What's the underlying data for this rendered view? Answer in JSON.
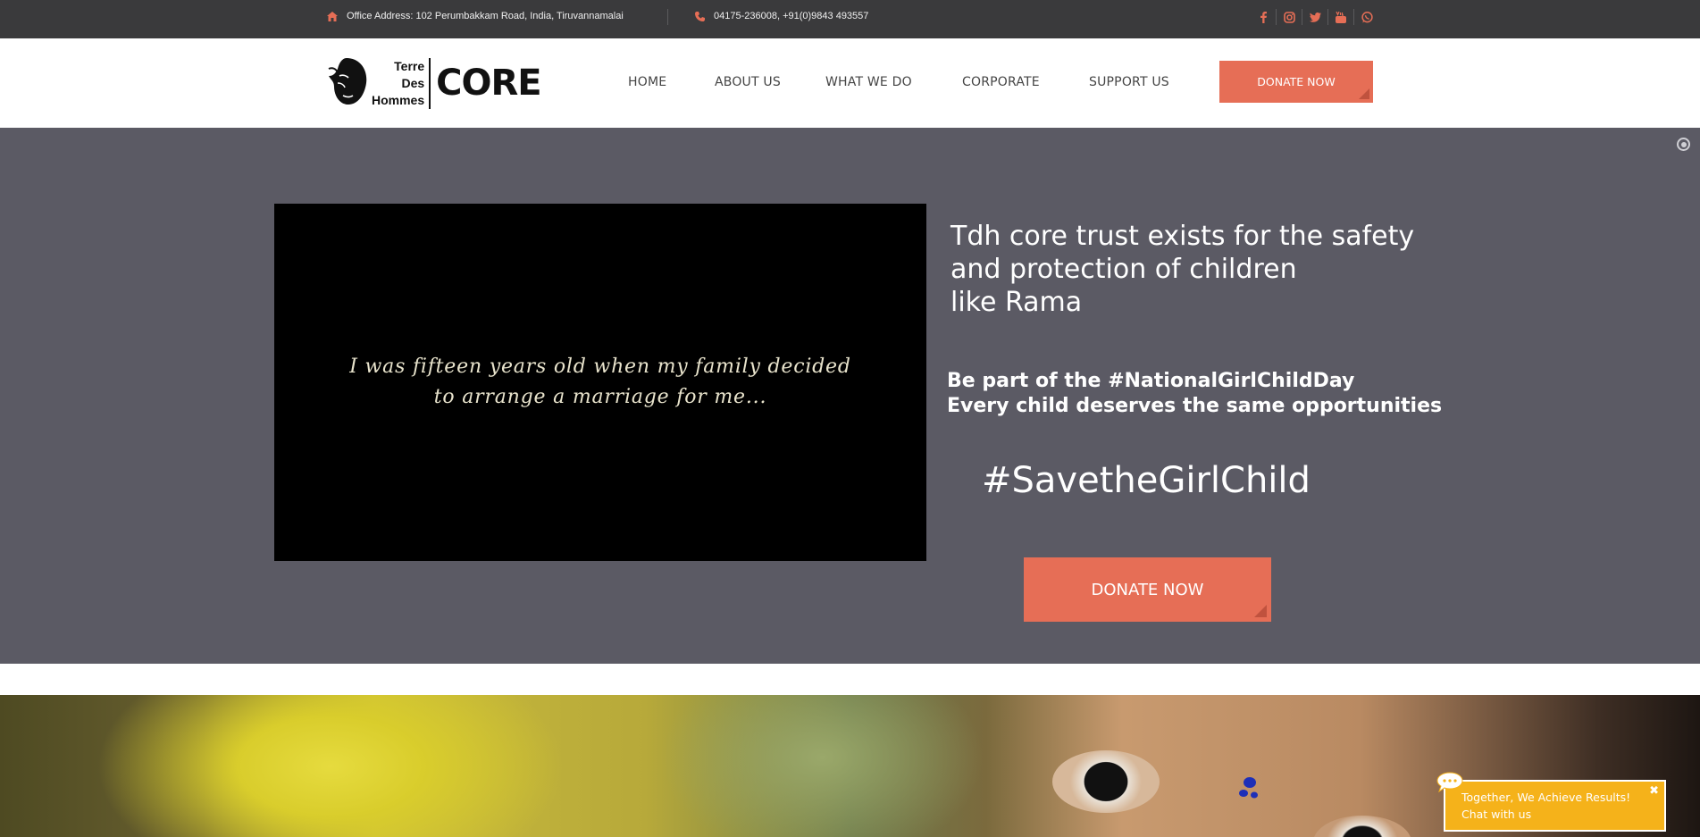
{
  "topbar": {
    "address": "Office Address: 102 Perumbakkam Road, India, Tiruvannamalai",
    "phone": "04175-236008, +91(0)9843 493557",
    "icons": [
      "home-icon",
      "phone-icon"
    ],
    "socials": [
      "facebook-icon",
      "instagram-icon",
      "twitter-icon",
      "youtube-icon",
      "whatsapp-icon"
    ]
  },
  "header": {
    "logo": {
      "line1": "Terre",
      "line2": "Des",
      "line3": "Hommes",
      "brand": "CORE"
    },
    "nav": [
      "HOME",
      "ABOUT US",
      "WHAT WE DO",
      "CORPORATE",
      "SUPPORT US"
    ],
    "donate_label": "DONATE NOW"
  },
  "hero": {
    "video_caption_line1": "I was fifteen years old when my family decided",
    "video_caption_line2": "to arrange a marriage for me...",
    "title_line1": "Tdh core trust exists for the safety",
    "title_line2": "and protection of children",
    "title_line3": "like Rama",
    "sub_line1": "Be part of the #NationalGirlChildDay",
    "sub_line2": "Every child deserves the same opportunities",
    "hashtag": "#SavetheGirlChild",
    "donate_label": "DONATE NOW"
  },
  "chat": {
    "line1": "Together, We Achieve Results!",
    "line2": "Chat with us",
    "close": "✖"
  },
  "colors": {
    "accent": "#e66e56",
    "topbar_bg": "#3a3a3c",
    "hero_bg": "#5b5a64",
    "chat_bg": "#f5b21a"
  }
}
